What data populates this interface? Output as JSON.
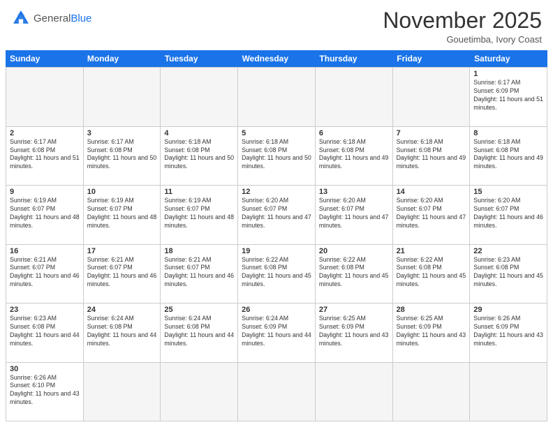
{
  "header": {
    "logo_general": "General",
    "logo_blue": "Blue",
    "month_title": "November 2025",
    "location": "Gouetimba, Ivory Coast"
  },
  "days": [
    "Sunday",
    "Monday",
    "Tuesday",
    "Wednesday",
    "Thursday",
    "Friday",
    "Saturday"
  ],
  "cells": [
    {
      "day": null,
      "empty": true
    },
    {
      "day": null,
      "empty": true
    },
    {
      "day": null,
      "empty": true
    },
    {
      "day": null,
      "empty": true
    },
    {
      "day": null,
      "empty": true
    },
    {
      "day": null,
      "empty": true
    },
    {
      "day": 1,
      "sunrise": "6:17 AM",
      "sunset": "6:09 PM",
      "daylight": "11 hours and 51 minutes."
    },
    {
      "day": 2,
      "sunrise": "6:17 AM",
      "sunset": "6:08 PM",
      "daylight": "11 hours and 51 minutes."
    },
    {
      "day": 3,
      "sunrise": "6:17 AM",
      "sunset": "6:08 PM",
      "daylight": "11 hours and 50 minutes."
    },
    {
      "day": 4,
      "sunrise": "6:18 AM",
      "sunset": "6:08 PM",
      "daylight": "11 hours and 50 minutes."
    },
    {
      "day": 5,
      "sunrise": "6:18 AM",
      "sunset": "6:08 PM",
      "daylight": "11 hours and 50 minutes."
    },
    {
      "day": 6,
      "sunrise": "6:18 AM",
      "sunset": "6:08 PM",
      "daylight": "11 hours and 49 minutes."
    },
    {
      "day": 7,
      "sunrise": "6:18 AM",
      "sunset": "6:08 PM",
      "daylight": "11 hours and 49 minutes."
    },
    {
      "day": 8,
      "sunrise": "6:18 AM",
      "sunset": "6:08 PM",
      "daylight": "11 hours and 49 minutes."
    },
    {
      "day": 9,
      "sunrise": "6:19 AM",
      "sunset": "6:07 PM",
      "daylight": "11 hours and 48 minutes."
    },
    {
      "day": 10,
      "sunrise": "6:19 AM",
      "sunset": "6:07 PM",
      "daylight": "11 hours and 48 minutes."
    },
    {
      "day": 11,
      "sunrise": "6:19 AM",
      "sunset": "6:07 PM",
      "daylight": "11 hours and 48 minutes."
    },
    {
      "day": 12,
      "sunrise": "6:20 AM",
      "sunset": "6:07 PM",
      "daylight": "11 hours and 47 minutes."
    },
    {
      "day": 13,
      "sunrise": "6:20 AM",
      "sunset": "6:07 PM",
      "daylight": "11 hours and 47 minutes."
    },
    {
      "day": 14,
      "sunrise": "6:20 AM",
      "sunset": "6:07 PM",
      "daylight": "11 hours and 47 minutes."
    },
    {
      "day": 15,
      "sunrise": "6:20 AM",
      "sunset": "6:07 PM",
      "daylight": "11 hours and 46 minutes."
    },
    {
      "day": 16,
      "sunrise": "6:21 AM",
      "sunset": "6:07 PM",
      "daylight": "11 hours and 46 minutes."
    },
    {
      "day": 17,
      "sunrise": "6:21 AM",
      "sunset": "6:07 PM",
      "daylight": "11 hours and 46 minutes."
    },
    {
      "day": 18,
      "sunrise": "6:21 AM",
      "sunset": "6:07 PM",
      "daylight": "11 hours and 46 minutes."
    },
    {
      "day": 19,
      "sunrise": "6:22 AM",
      "sunset": "6:08 PM",
      "daylight": "11 hours and 45 minutes."
    },
    {
      "day": 20,
      "sunrise": "6:22 AM",
      "sunset": "6:08 PM",
      "daylight": "11 hours and 45 minutes."
    },
    {
      "day": 21,
      "sunrise": "6:22 AM",
      "sunset": "6:08 PM",
      "daylight": "11 hours and 45 minutes."
    },
    {
      "day": 22,
      "sunrise": "6:23 AM",
      "sunset": "6:08 PM",
      "daylight": "11 hours and 45 minutes."
    },
    {
      "day": 23,
      "sunrise": "6:23 AM",
      "sunset": "6:08 PM",
      "daylight": "11 hours and 44 minutes."
    },
    {
      "day": 24,
      "sunrise": "6:24 AM",
      "sunset": "6:08 PM",
      "daylight": "11 hours and 44 minutes."
    },
    {
      "day": 25,
      "sunrise": "6:24 AM",
      "sunset": "6:08 PM",
      "daylight": "11 hours and 44 minutes."
    },
    {
      "day": 26,
      "sunrise": "6:24 AM",
      "sunset": "6:09 PM",
      "daylight": "11 hours and 44 minutes."
    },
    {
      "day": 27,
      "sunrise": "6:25 AM",
      "sunset": "6:09 PM",
      "daylight": "11 hours and 43 minutes."
    },
    {
      "day": 28,
      "sunrise": "6:25 AM",
      "sunset": "6:09 PM",
      "daylight": "11 hours and 43 minutes."
    },
    {
      "day": 29,
      "sunrise": "6:26 AM",
      "sunset": "6:09 PM",
      "daylight": "11 hours and 43 minutes."
    },
    {
      "day": 30,
      "sunrise": "6:26 AM",
      "sunset": "6:10 PM",
      "daylight": "11 hours and 43 minutes."
    },
    {
      "day": null,
      "empty": true,
      "last": true
    },
    {
      "day": null,
      "empty": true,
      "last": true
    },
    {
      "day": null,
      "empty": true,
      "last": true
    },
    {
      "day": null,
      "empty": true,
      "last": true
    },
    {
      "day": null,
      "empty": true,
      "last": true
    },
    {
      "day": null,
      "empty": true,
      "last": true
    }
  ],
  "labels": {
    "sunrise": "Sunrise:",
    "sunset": "Sunset:",
    "daylight": "Daylight:"
  }
}
